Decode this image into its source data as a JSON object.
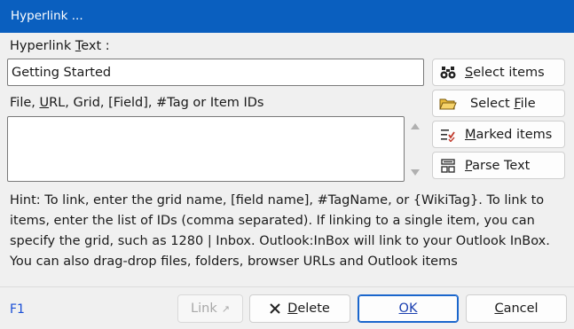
{
  "window": {
    "title": "Hyperlink ..."
  },
  "hyperlink_text": {
    "label_pre": "Hyperlink ",
    "label_mnemonic": "T",
    "label_post": "ext :",
    "value": "Getting Started"
  },
  "target": {
    "label_pre": "File, ",
    "label_mnemonic": "U",
    "label_post": "RL, Grid, [Field], #Tag or Item IDs",
    "value": ""
  },
  "side_buttons": [
    {
      "icon": "binoculars-icon",
      "pre": "",
      "mnemonic": "S",
      "post": "elect items"
    },
    {
      "icon": "folder-icon",
      "pre": "Select ",
      "mnemonic": "F",
      "post": "ile"
    },
    {
      "icon": "marked-list-icon",
      "pre": "",
      "mnemonic": "M",
      "post": "arked items"
    },
    {
      "icon": "parse-grid-icon",
      "pre": "",
      "mnemonic": "P",
      "post": "arse Text"
    }
  ],
  "hint_lines": [
    "Hint: To link, enter the grid name, [field name], #TagName, or {WikiTag}. To link to",
    "items, enter the list of IDs (comma separated). If linking to a single item, you can",
    "specify the grid, such as 1280 | Inbox. Outlook:InBox will link to your Outlook InBox.",
    "You can also drag-drop files, folders, browser URLs and Outlook items"
  ],
  "footer": {
    "help": "F1",
    "link_label": "Link",
    "link_arrow": "↗",
    "delete_mnemonic": "D",
    "delete_post": "elete",
    "ok_mnemonic": "O",
    "ok_post": "K",
    "cancel_mnemonic": "C",
    "cancel_post": "ancel"
  },
  "colors": {
    "titlebar": "#0a5fbf",
    "accent": "#1a66cc",
    "help_link": "#1a4fd6",
    "delete_x": "#222222"
  }
}
